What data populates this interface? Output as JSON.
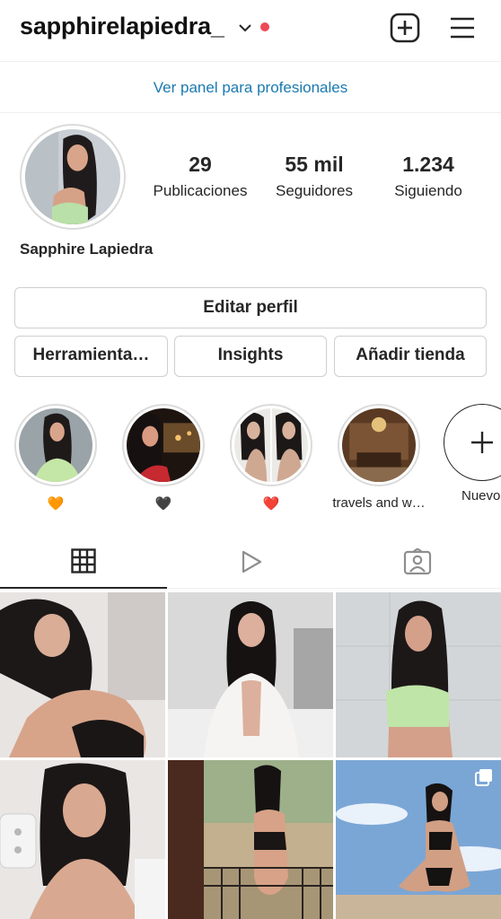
{
  "header": {
    "username": "sapphirelapiedra_",
    "icons": [
      "chevron-down-icon",
      "notification-dot",
      "new-post-icon",
      "menu-icon"
    ]
  },
  "pro_panel": {
    "label": "Ver panel para profesionales"
  },
  "profile": {
    "full_name": "Sapphire Lapiedra",
    "stats": {
      "posts": {
        "value": "29",
        "label": "Publicaciones"
      },
      "followers": {
        "value": "55 mil",
        "label": "Seguidores"
      },
      "following": {
        "value": "1.234",
        "label": "Siguiendo"
      }
    }
  },
  "buttons": {
    "edit": "Editar perfil",
    "tools": "Herramienta…",
    "insights": "Insights",
    "shop": "Añadir tienda"
  },
  "highlights": [
    {
      "label": "🧡"
    },
    {
      "label": "🖤"
    },
    {
      "label": "❤️"
    },
    {
      "label": "travels and w…"
    },
    {
      "label": "Nuevo"
    }
  ],
  "tabs": [
    "grid-icon",
    "reels-icon",
    "tagged-icon"
  ],
  "colors": {
    "accent_link": "#1a7ab0",
    "notification_dot": "#ed4956",
    "border": "#dbdbdb",
    "text": "#262626"
  }
}
